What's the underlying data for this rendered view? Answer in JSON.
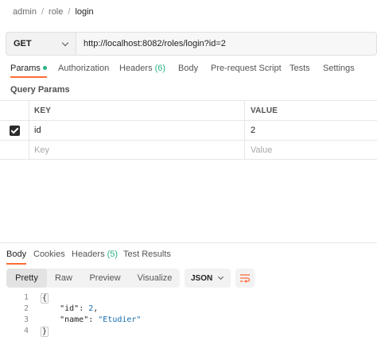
{
  "breadcrumb": {
    "items": [
      "admin",
      "role"
    ],
    "current": "login",
    "separator": "/"
  },
  "request": {
    "method": "GET",
    "url": "http://localhost:8082/roles/login?id=2"
  },
  "request_tabs": {
    "params": "Params",
    "authorization": "Authorization",
    "headers": "Headers",
    "headers_count": "(6)",
    "body": "Body",
    "prerequest": "Pre-request Script",
    "tests": "Tests",
    "settings": "Settings"
  },
  "query_params": {
    "title": "Query Params",
    "columns": [
      "KEY",
      "VALUE"
    ],
    "rows": [
      {
        "key": "id",
        "value": "2",
        "checked": true
      }
    ],
    "placeholder": {
      "key": "Key",
      "value": "Value"
    }
  },
  "response_tabs": {
    "body": "Body",
    "cookies": "Cookies",
    "headers": "Headers",
    "headers_count": "(5)",
    "test_results": "Test Results"
  },
  "format_tabs": [
    "Pretty",
    "Raw",
    "Preview",
    "Visualize"
  ],
  "active_format": "Pretty",
  "language": "JSON",
  "response_body": {
    "line_numbers": [
      "1",
      "2",
      "3",
      "4"
    ],
    "open": "{",
    "close": "}",
    "id_key": "\"id\"",
    "id_value": "2",
    "name_key": "\"name\"",
    "name_value": "\"Etudier\""
  },
  "colors": {
    "accent": "#ff6c37",
    "status_green": "#26b47f",
    "json_value": "#1a6fb0"
  }
}
